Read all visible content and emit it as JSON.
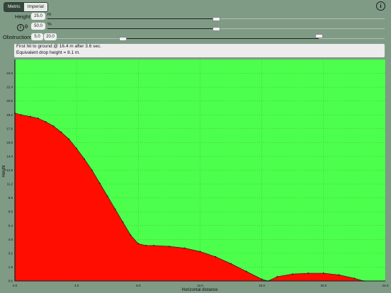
{
  "units": {
    "metric_label": "Metric",
    "imperial_label": "Imperial",
    "selected": "Metric"
  },
  "info_icon": "i",
  "height": {
    "label": "Height",
    "value": "25.0",
    "unit": "m",
    "level": 0.5
  },
  "angle": {
    "label": "θ",
    "icon": "i",
    "value": "50.0",
    "unit": "%",
    "level": 0.5
  },
  "obstructions": {
    "label": "Obstructions",
    "start": "5.0",
    "end": "20.0",
    "range_start": 0.2,
    "range_end": 0.8
  },
  "result": {
    "line1": "First hit to ground @ 16.4 m after 3.6 sec.",
    "line2": "Equivalent drop height = 8.1 m."
  },
  "colors": {
    "safe": "#4dff4d",
    "danger": "#ff0d00",
    "background": "#7f9b86"
  },
  "chart_data": {
    "type": "area",
    "xlabel": "Horizontal distance",
    "ylabel": "Height",
    "xlim": [
      0,
      24
    ],
    "ylim": [
      0,
      25.6
    ],
    "xticks": [
      "0.0",
      "4.0",
      "8.0",
      "12.0",
      "16.0",
      "20.0",
      "24.0"
    ],
    "yticks": [
      "0.0",
      "1.6",
      "3.2",
      "4.8",
      "6.4",
      "8.0",
      "9.6",
      "11.2",
      "12.8",
      "14.4",
      "16.0",
      "17.6",
      "19.2",
      "20.8",
      "22.4",
      "24.0"
    ],
    "grid": true,
    "series": [
      {
        "x": [
          0,
          0.4,
          1,
          1.5,
          2,
          2.5,
          3,
          3.5,
          4,
          4.5,
          5,
          5.5,
          6,
          6.5,
          7,
          7.5,
          8,
          8.5,
          9,
          10,
          11,
          12,
          13,
          14,
          15,
          16,
          16.4,
          17,
          18,
          19,
          20,
          21,
          22,
          22.6
        ],
        "y": [
          19.4,
          19.2,
          19.0,
          18.8,
          18.4,
          17.9,
          17.2,
          16.4,
          15.3,
          14.1,
          12.8,
          11.3,
          9.8,
          8.3,
          6.8,
          5.3,
          4.3,
          4.1,
          4.1,
          4.0,
          3.8,
          3.4,
          2.8,
          2.0,
          1.1,
          0.2,
          0.0,
          0.5,
          0.8,
          0.9,
          0.9,
          0.7,
          0.3,
          0.0
        ]
      }
    ]
  }
}
